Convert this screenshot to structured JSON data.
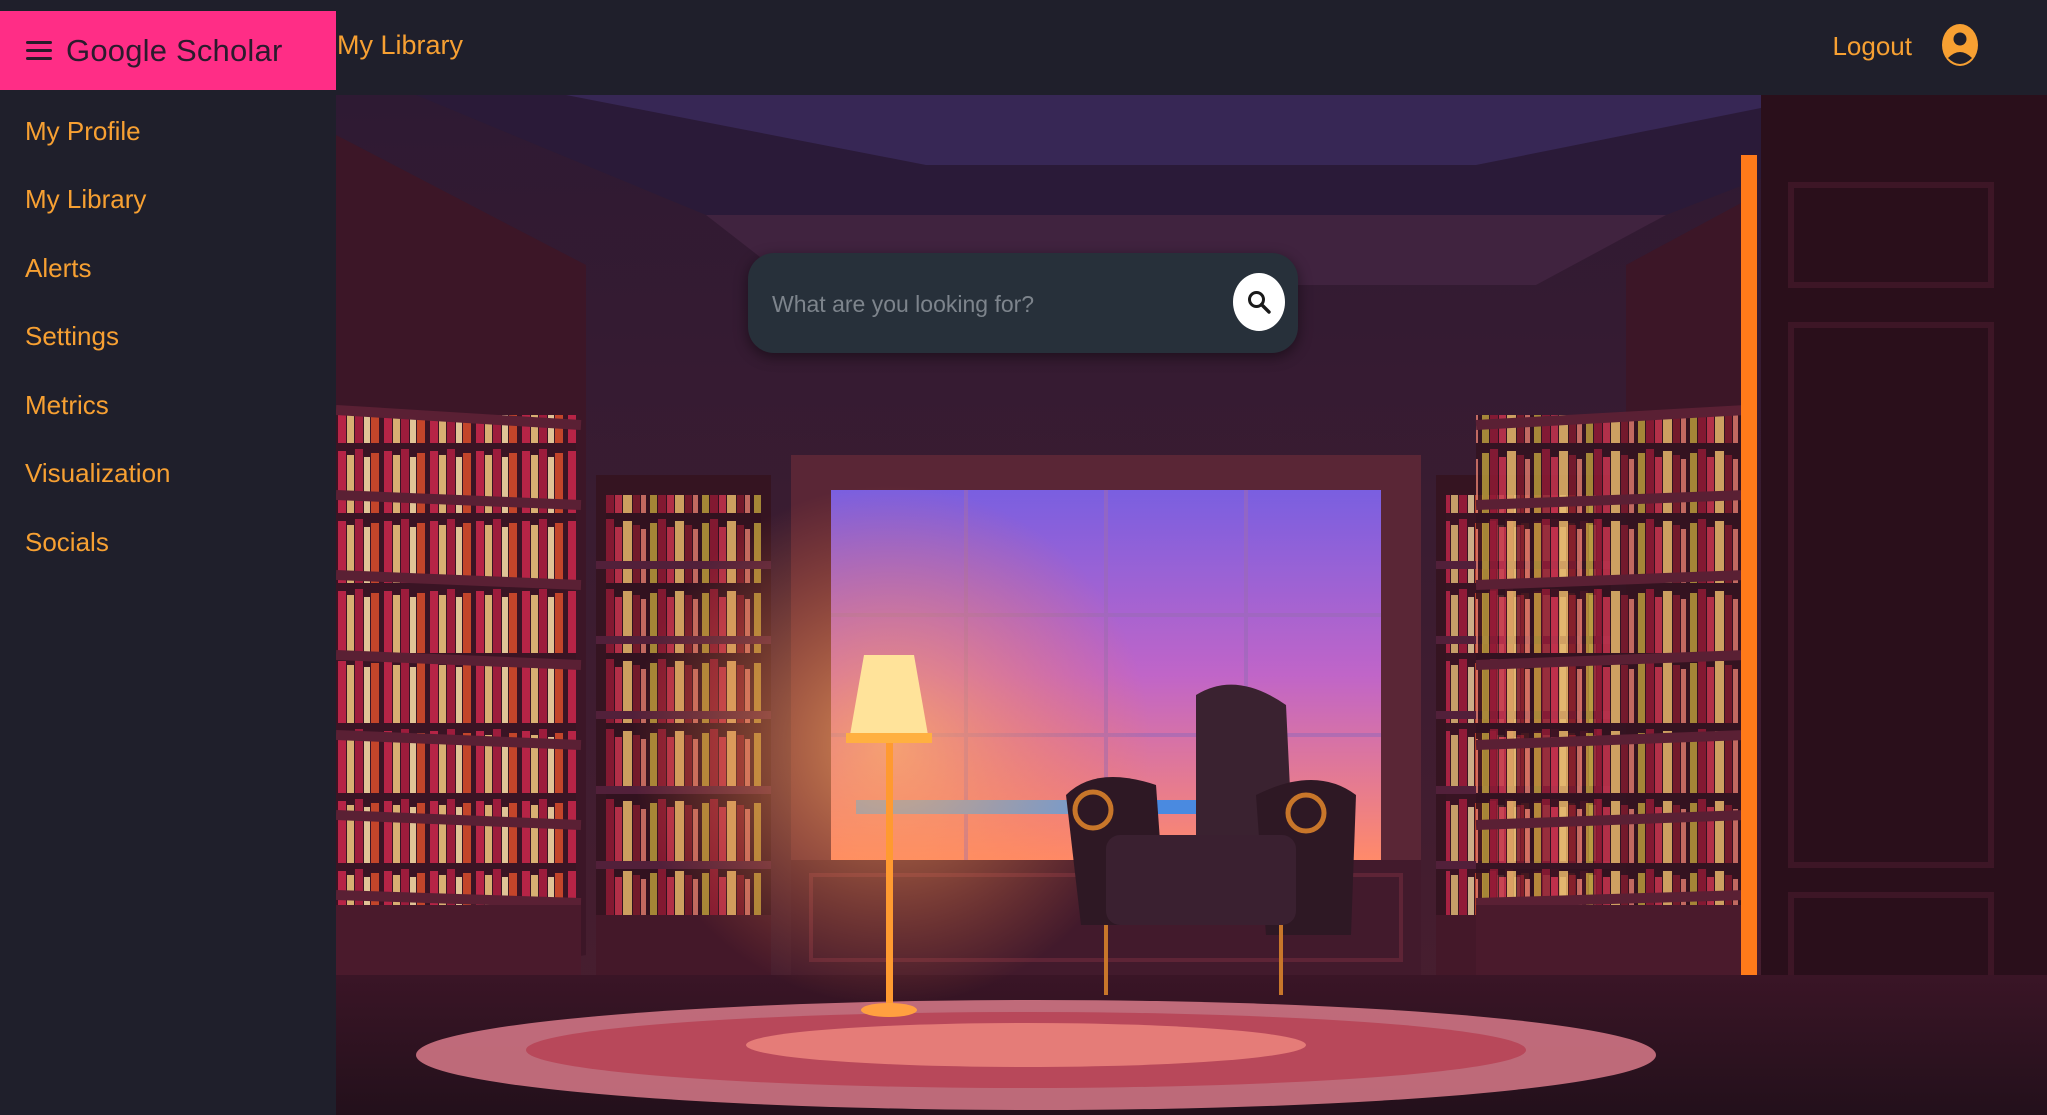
{
  "header": {
    "brand": "Google Scholar",
    "page_title": "My Library",
    "logout_label": "Logout",
    "menu_icon": "hamburger-icon",
    "user_icon": "user-circle-icon"
  },
  "sidebar": {
    "items": [
      {
        "label": "My Profile"
      },
      {
        "label": "My Library"
      },
      {
        "label": "Alerts"
      },
      {
        "label": "Settings"
      },
      {
        "label": "Metrics"
      },
      {
        "label": "Visualization"
      },
      {
        "label": "Socials"
      }
    ]
  },
  "search": {
    "placeholder": "What are you looking for?",
    "value": "",
    "icon": "search-icon"
  },
  "colors": {
    "accent": "#f7a032",
    "brand_bg": "#ff2d86",
    "bar_bg": "#1f1f2b"
  }
}
